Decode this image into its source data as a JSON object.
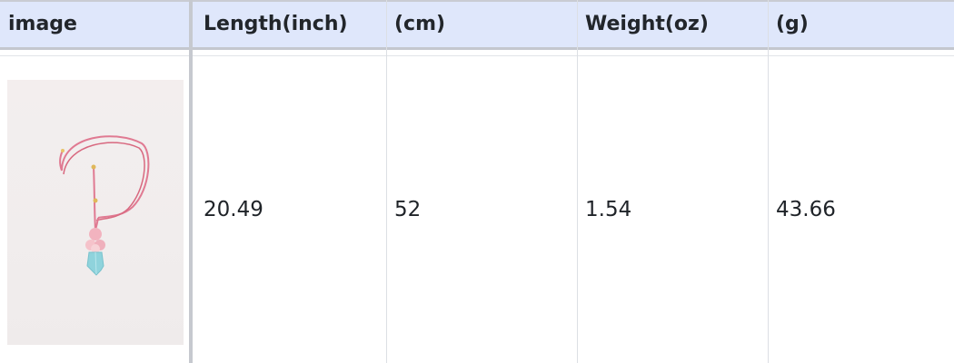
{
  "table": {
    "headers": [
      "image",
      "Length(inch)",
      "(cm)",
      "Weight(oz)",
      "(g)"
    ],
    "rows": [
      {
        "image": "pink cord necklace with blue crystal pendant",
        "length_inch": "20.49",
        "length_cm": "52",
        "weight_oz": "1.54",
        "weight_g": "43.66"
      }
    ]
  },
  "colors": {
    "header_bg": "#dfe7fb",
    "cord": "#e0758d",
    "crystal": "#8fd3dc",
    "bead": "#f2b7c1"
  }
}
